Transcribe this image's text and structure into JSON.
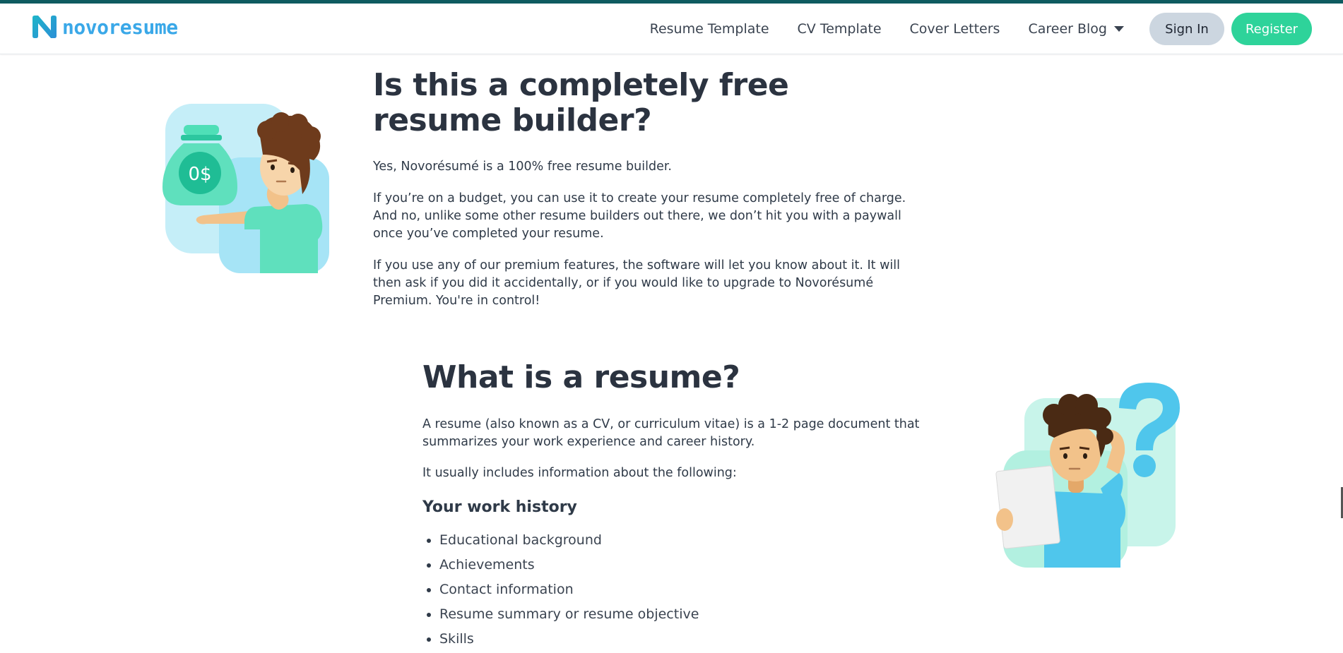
{
  "header": {
    "logo_text": "novoresume",
    "nav": {
      "resume_template": "Resume Template",
      "cv_template": "CV Template",
      "cover_letters": "Cover Letters",
      "career_blog": "Career Blog"
    },
    "sign_in": "Sign In",
    "register": "Register"
  },
  "faq_free": {
    "title": "Is this a completely free resume builder?",
    "paragraphs": [
      "Yes, Novorésumé is a 100% free resume builder.",
      "If you’re on a budget, you can use it to create your resume completely free of charge. And no, unlike some other resume builders out there, we don’t hit you with a paywall once you’ve completed your resume.",
      "If you use any of our premium features, the software will let you know about it. It will then ask if you did it accidentally, or if you would like to upgrade to Novorésumé Premium. You're in control!"
    ],
    "money_bag_label": "0$"
  },
  "what_is_resume": {
    "title": "What is a resume?",
    "paragraphs": [
      "A resume (also known as a CV, or curriculum vitae) is a 1-2 page document that summarizes your work experience and career history.",
      "It usually includes information about the following:"
    ],
    "subheading": "Your work history",
    "items": [
      "Educational background",
      "Achievements",
      "Contact information",
      "Resume summary or resume objective",
      "Skills"
    ]
  },
  "colors": {
    "brand_teal": "#0e5b60",
    "brand_blue": "#3aa8e8",
    "register_green": "#2ed39a",
    "signin_gray": "#ccd6e0",
    "heading": "#2b3340",
    "illustration_mint": "#5fe0bd",
    "illustration_sky": "#4fc6ec"
  }
}
